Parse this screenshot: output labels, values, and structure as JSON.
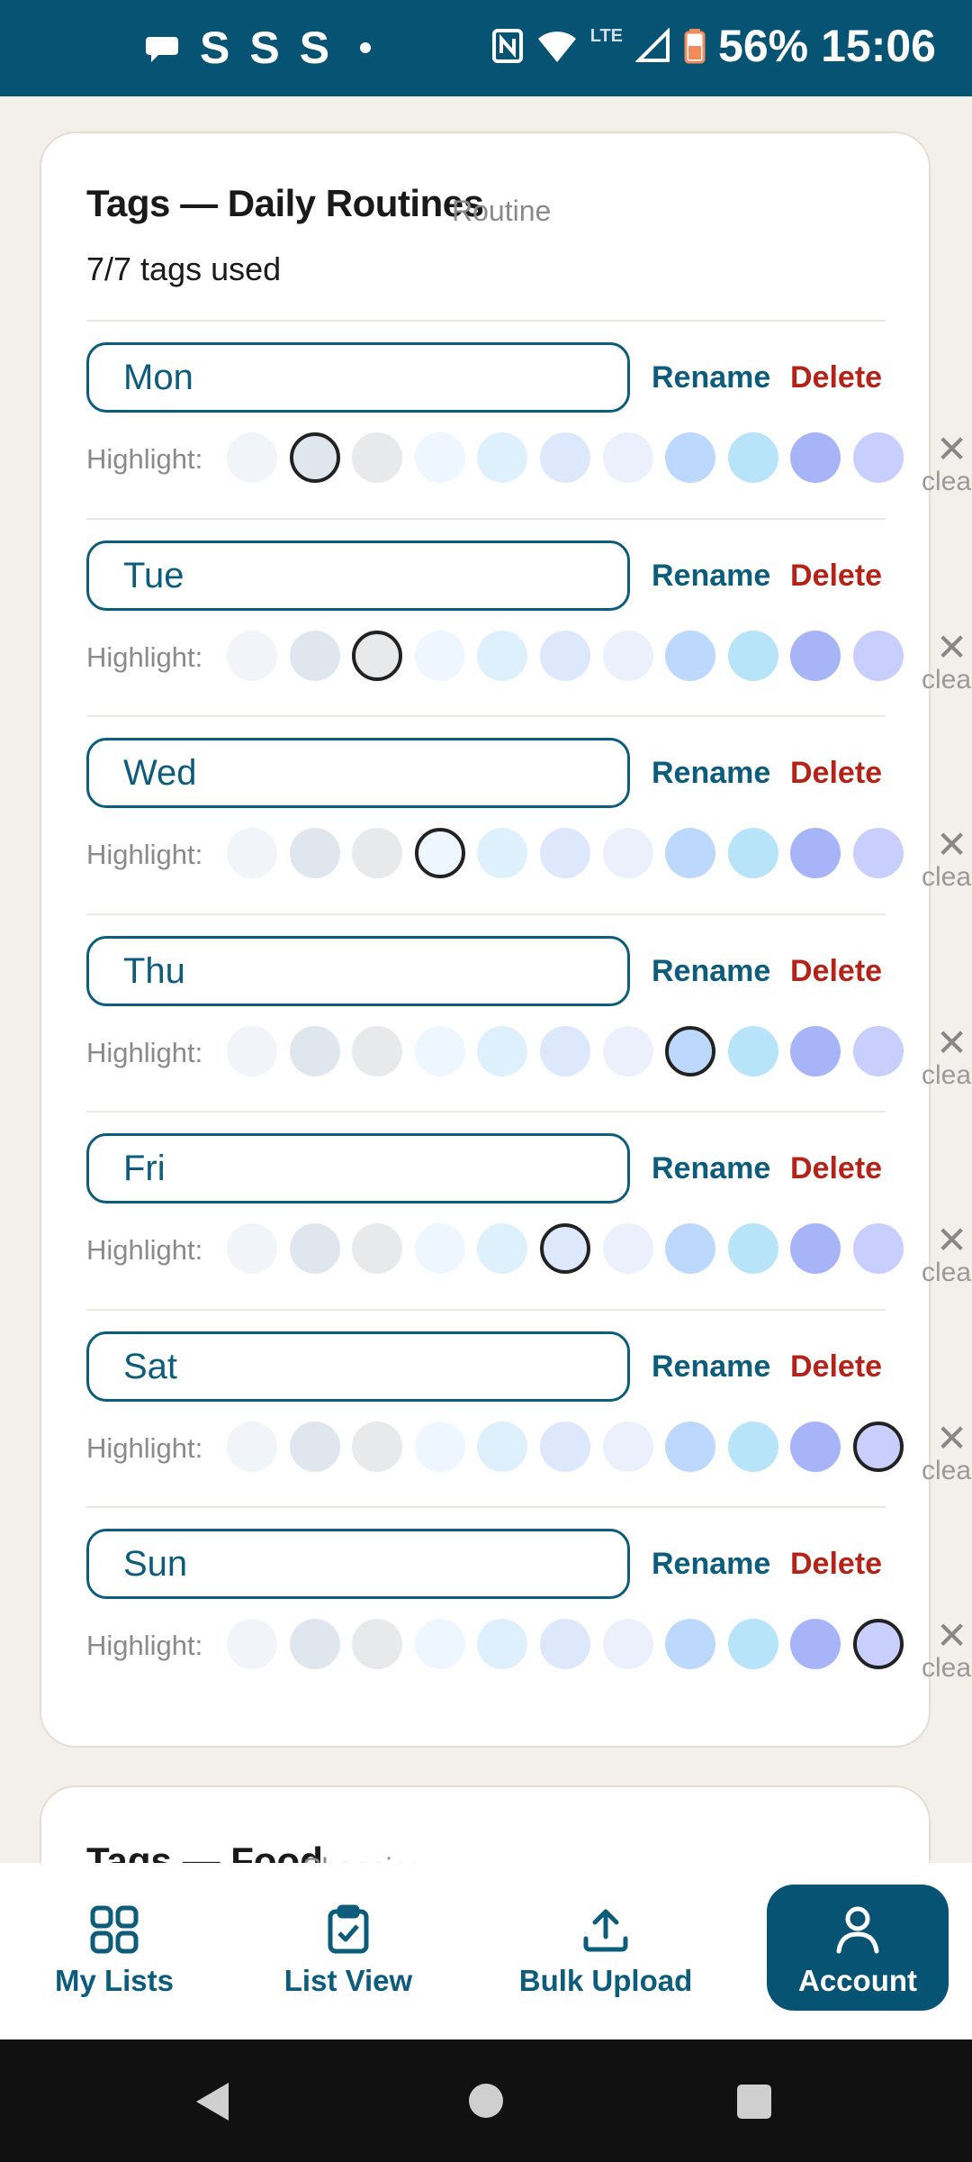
{
  "status_bar": {
    "left_icons": [
      "chat-icon",
      "s-icon",
      "s-icon",
      "s-icon"
    ],
    "right_icons": [
      "nfc-icon",
      "wifi-icon",
      "signal-icon",
      "battery-icon"
    ],
    "network": "LTE",
    "battery": "56%",
    "time": "15:06"
  },
  "card": {
    "title": "Tags — Daily Routines",
    "subtitle": "Routine",
    "count": "7/7 tags used",
    "highlight_label": "Highlight:",
    "rename_label": "Rename",
    "delete_label": "Delete",
    "clear_label": "clear",
    "swatch_colors": [
      "#f1f4f8",
      "#e0e6ee",
      "#e8e9eb",
      "#eef6ff",
      "#dff0fd",
      "#dde8fd",
      "#ecf0fd",
      "#bcd8fc",
      "#b8e4fa",
      "#a8b4f8",
      "#c8cffc"
    ],
    "tags": [
      {
        "name": "Mon",
        "selected": 1
      },
      {
        "name": "Tue",
        "selected": 2
      },
      {
        "name": "Wed",
        "selected": 3
      },
      {
        "name": "Thu",
        "selected": 7
      },
      {
        "name": "Fri",
        "selected": 5
      },
      {
        "name": "Sat",
        "selected": 10
      },
      {
        "name": "Sun",
        "selected": 10
      }
    ]
  },
  "card2": {
    "title": "Tags — Food",
    "subtitle": "Shopping"
  },
  "bottom_nav": {
    "items": [
      {
        "label": "My Lists",
        "icon": "grid-icon",
        "active": false
      },
      {
        "label": "List View",
        "icon": "clipboard-check-icon",
        "active": false
      },
      {
        "label": "Bulk Upload",
        "icon": "upload-icon",
        "active": false
      },
      {
        "label": "Account",
        "icon": "user-icon",
        "active": true
      }
    ]
  },
  "system_nav": {
    "icons": [
      "back-icon",
      "home-icon",
      "recents-icon"
    ]
  }
}
